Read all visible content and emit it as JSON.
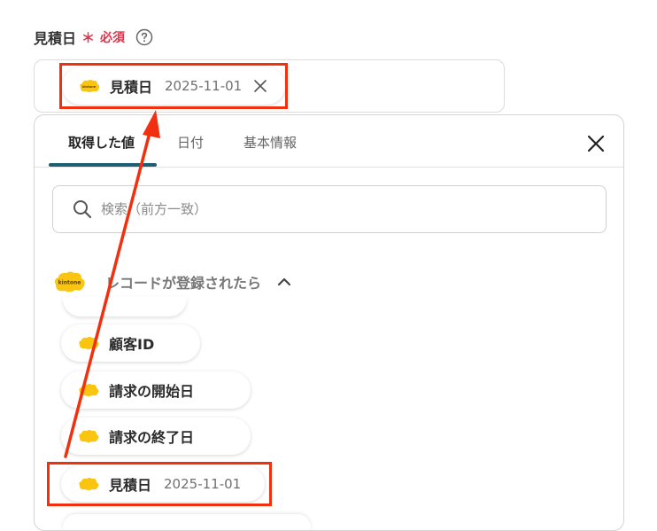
{
  "field": {
    "label": "見積日",
    "required_mark": "＊",
    "required_text": "必須",
    "help_icon": "question-circle-icon"
  },
  "selected_value": {
    "name": "見積日",
    "value": "2025-11-01",
    "logo_text": "kintone",
    "remove_icon": "close-icon"
  },
  "panel": {
    "tabs": [
      {
        "label": "取得した値",
        "active": true
      },
      {
        "label": "日付",
        "active": false
      },
      {
        "label": "基本情報",
        "active": false
      }
    ],
    "close_icon": "close-icon",
    "search": {
      "placeholder": "検索（前方一致）",
      "value": "",
      "icon": "search-icon"
    },
    "group": {
      "logo_text": "kintone",
      "title": "レコードが登録されたら",
      "expanded": true,
      "chevron_icon": "chevron-up-icon"
    },
    "items": [
      {
        "name": "顧客ID",
        "value": ""
      },
      {
        "name": "請求の開始日",
        "value": ""
      },
      {
        "name": "請求の終了日",
        "value": ""
      },
      {
        "name": "見積日",
        "value": "2025-11-01"
      }
    ]
  },
  "colors": {
    "accent": "#1e5f73",
    "required": "#e0334a",
    "annotation": "#f2300f",
    "kintone_yellow": "#f9c510"
  }
}
